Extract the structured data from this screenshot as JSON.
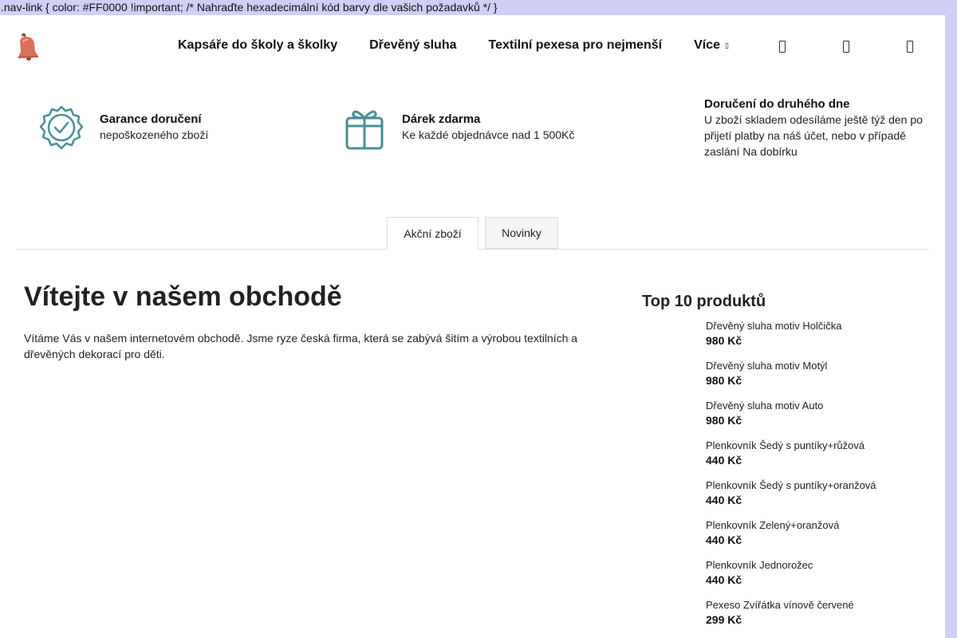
{
  "css_leak_text": ".nav-link { color: #FF0000 !important; /* Nahraďte hexadecimální kód barvy dle vašich požadavků */ }",
  "header": {
    "logo_icon": "bell-icon",
    "nav": [
      {
        "label": "Kapsáře do školy a školky"
      },
      {
        "label": "Dřevěný sluha"
      },
      {
        "label": "Textilní pexesa pro nejmenší"
      },
      {
        "label": "Více"
      }
    ],
    "icons": [
      "search-icon",
      "user-icon",
      "cart-icon"
    ]
  },
  "benefits": [
    {
      "icon": "badge-check-icon",
      "title": "Garance doručení",
      "text": "nepoškozeného zboží"
    },
    {
      "icon": "gift-icon",
      "title": "Dárek zdarma",
      "text": "Ke každé objednávce nad 1 500Kč"
    },
    {
      "icon": "",
      "title": "Doručení do druhého dne",
      "text": "U zboží skladem odesíláme ještě týž den po přijetí platby na náš účet, nebo v případě zaslání Na dobírku"
    }
  ],
  "tabs": [
    {
      "label": "Akční zboží",
      "active": true
    },
    {
      "label": "Novinky",
      "active": false
    }
  ],
  "main": {
    "title": "Vítejte v našem obchodě",
    "text": "Vítáme Vás v našem internetovém obchodě. Jsme ryze česká firma, která se zabývá šitím a výrobou textilních a dřevěných dekorací pro děti."
  },
  "sidebar": {
    "title": "Top 10 produktů",
    "products": [
      {
        "name": "Dřevěný sluha motiv Holčička",
        "price": "980 Kč"
      },
      {
        "name": "Dřevěný sluha motiv Motýl",
        "price": "980 Kč"
      },
      {
        "name": "Dřevěný sluha motiv Auto",
        "price": "980 Kč"
      },
      {
        "name": "Plenkovník Šedý s puntíky+růžová",
        "price": "440 Kč"
      },
      {
        "name": "Plenkovník Šedý s puntíky+oranžová",
        "price": "440 Kč"
      },
      {
        "name": "Plenkovník Zelený+oranžová",
        "price": "440 Kč"
      },
      {
        "name": "Plenkovník Jednorožec",
        "price": "440 Kč"
      },
      {
        "name": "Pexeso Zvířátka vínově červené",
        "price": "299 Kč"
      }
    ]
  },
  "colors": {
    "accent": "#4a8f96",
    "top_bar_bg": "#cfcff7",
    "logo_bell": "#d9705a"
  }
}
